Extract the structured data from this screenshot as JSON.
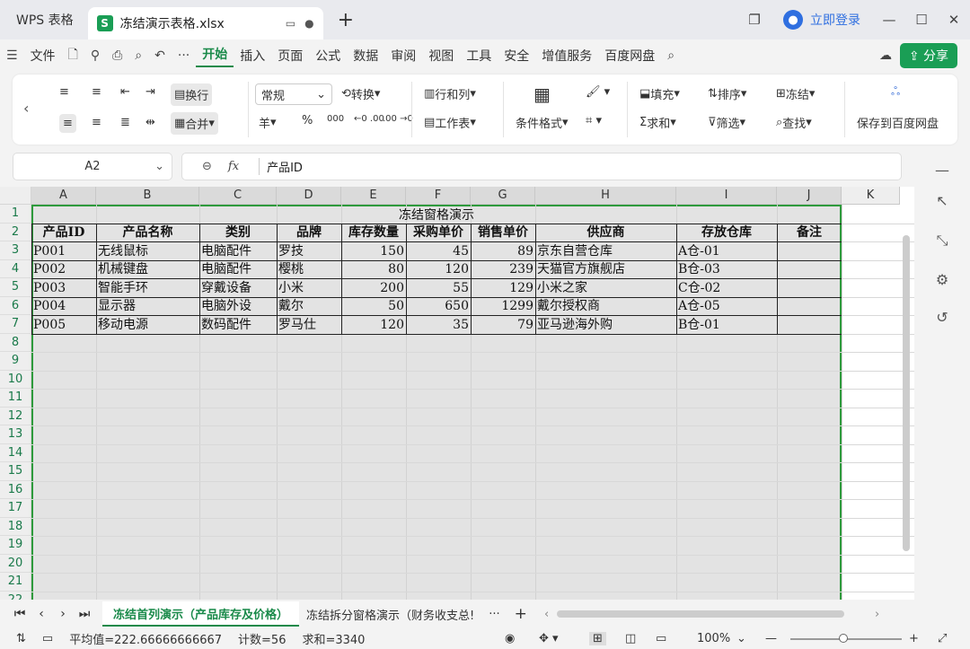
{
  "titlebar": {
    "app_tab": "WPS 表格",
    "doc_name": "冻结演示表格.xlsx",
    "login": "立即登录",
    "avatar_glyph": "●"
  },
  "menu": {
    "file": "文件",
    "items": [
      "开始",
      "插入",
      "页面",
      "公式",
      "数据",
      "审阅",
      "视图",
      "工具",
      "安全",
      "增值服务",
      "百度网盘"
    ],
    "share": "分享"
  },
  "ribbon": {
    "wrap": "换行",
    "merge": "合并",
    "format": "常规",
    "convert": "转换",
    "rowcol": "行和列",
    "worksheet": "工作表",
    "cond": "条件格式",
    "fill": "填充",
    "sort": "排序",
    "freeze": "冻结",
    "sum": "求和",
    "filter": "筛选",
    "find": "查找",
    "save_baidu": "保存到百度网盘",
    "yen": "羊",
    "percent": "%",
    "thousand": "000",
    "dec_inc": "←0 .00",
    "dec_dec": ".00 →0"
  },
  "formula": {
    "cellref": "A2",
    "fx": "fx",
    "value": "产品ID"
  },
  "columns": [
    "A",
    "B",
    "C",
    "D",
    "E",
    "F",
    "G",
    "H",
    "I",
    "J",
    "K"
  ],
  "rows": [
    "1",
    "2",
    "3",
    "4",
    "5",
    "6",
    "7",
    "8",
    "9",
    "10",
    "11",
    "12",
    "13",
    "14",
    "15",
    "16",
    "17",
    "18",
    "19",
    "20",
    "21",
    "22"
  ],
  "table": {
    "title": "冻结窗格演示",
    "headers": [
      "产品ID",
      "产品名称",
      "类别",
      "品牌",
      "库存数量",
      "采购单价",
      "销售单价",
      "供应商",
      "存放仓库",
      "备注"
    ],
    "data": [
      [
        "P001",
        "无线鼠标",
        "电脑配件",
        "罗技",
        "150",
        "45",
        "89",
        "京东自营仓库",
        "A仓-01",
        ""
      ],
      [
        "P002",
        "机械键盘",
        "电脑配件",
        "樱桃",
        "80",
        "120",
        "239",
        "天猫官方旗舰店",
        "B仓-03",
        ""
      ],
      [
        "P003",
        "智能手环",
        "穿戴设备",
        "小米",
        "200",
        "55",
        "129",
        "小米之家",
        "C仓-02",
        ""
      ],
      [
        "P004",
        "显示器",
        "电脑外设",
        "戴尔",
        "50",
        "650",
        "1299",
        "戴尔授权商",
        "A仓-05",
        ""
      ],
      [
        "P005",
        "移动电源",
        "数码配件",
        "罗马仕",
        "120",
        "35",
        "79",
        "亚马逊海外购",
        "B仓-01",
        ""
      ]
    ]
  },
  "sheets": {
    "active": "冻结首列演示（产品库存及价格）",
    "second": "冻结拆分窗格演示（财务收支总!",
    "more": "···",
    "add": "+"
  },
  "status": {
    "avg": "平均值=222.66666666667",
    "count": "计数=56",
    "sum": "求和=3340",
    "zoom": "100%"
  },
  "colors": {
    "accent": "#1a8a4a",
    "select_border": "#2e9a3c",
    "share_bg": "#1a9e55",
    "login": "#2f6fe0"
  }
}
